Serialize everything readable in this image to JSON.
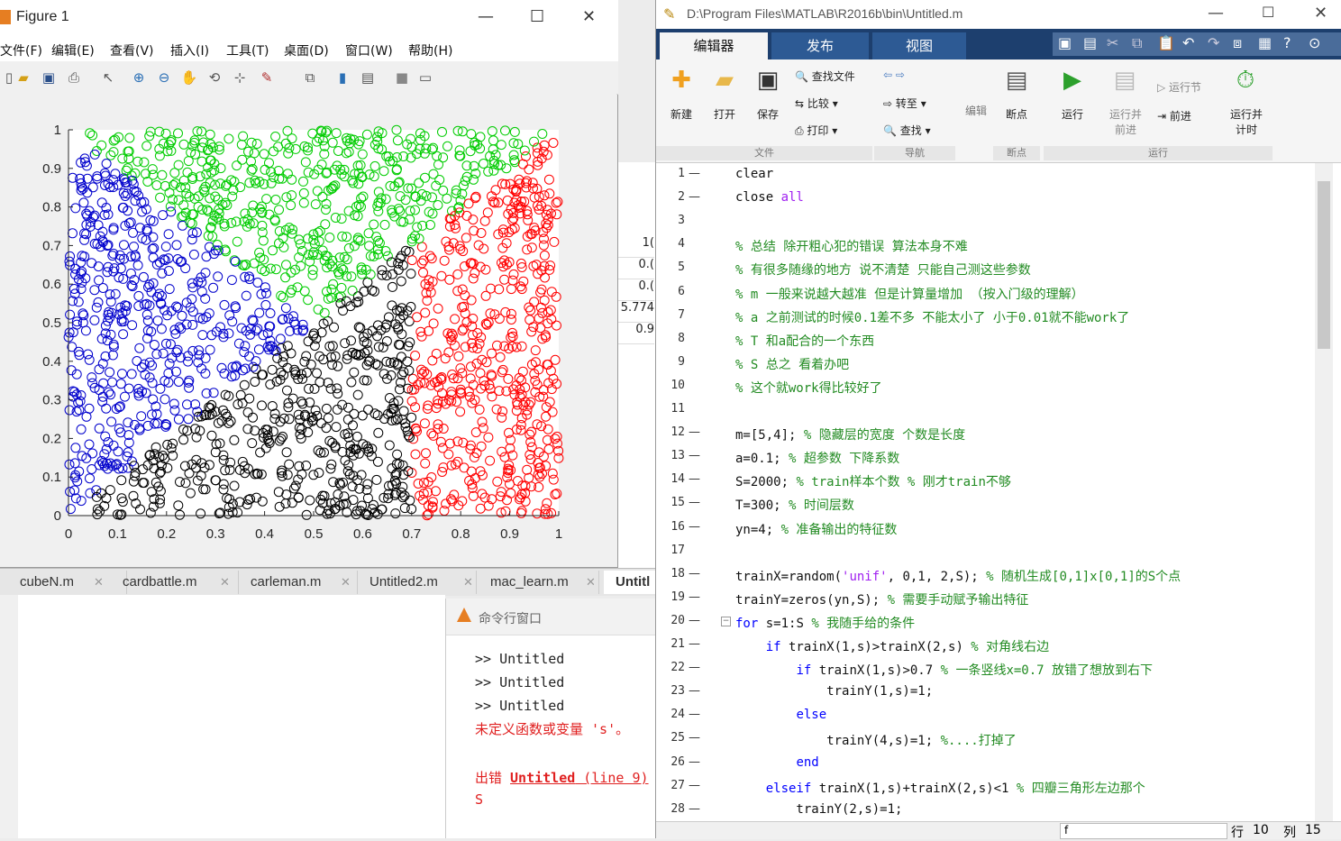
{
  "figure": {
    "title": "Figure 1",
    "menu": [
      "文件(F)",
      "编辑(E)",
      "查看(V)",
      "插入(I)",
      "工具(T)",
      "桌面(D)",
      "窗口(W)",
      "帮助(H)"
    ],
    "minimize": "—",
    "maximize": "☐",
    "close": "✕"
  },
  "chart_data": {
    "type": "scatter",
    "xlim": [
      0,
      1
    ],
    "ylim": [
      0,
      1
    ],
    "xticks": [
      "0",
      "0.1",
      "0.2",
      "0.3",
      "0.4",
      "0.5",
      "0.6",
      "0.7",
      "0.8",
      "0.9",
      "1"
    ],
    "yticks": [
      "0",
      "0.1",
      "0.2",
      "0.3",
      "0.4",
      "0.5",
      "0.6",
      "0.7",
      "0.8",
      "0.9",
      "1"
    ],
    "marker": "circle-open",
    "n_points": 2000,
    "series": [
      {
        "color": "#ff0000",
        "rule": "x > 0.7 (right of vertical line x=0.7, below diagonal)"
      },
      {
        "color": "#00cc00",
        "rule": "y > x and x + y > 1"
      },
      {
        "color": "#0000cc",
        "rule": "y > x and x + y < 1"
      },
      {
        "color": "#000000",
        "rule": "y < x and x + y < 1 or x < 0.7 below diagonal"
      }
    ],
    "colors": {
      "red": "#ff0000",
      "green": "#00cc00",
      "blue": "#0000cc",
      "black": "#000000"
    }
  },
  "editor": {
    "title": "D:\\Program Files\\MATLAB\\R2016b\\bin\\Untitled.m",
    "tabs": [
      "编辑器",
      "发布",
      "视图"
    ],
    "buttons": {
      "new": "新建",
      "open": "打开",
      "save": "保存",
      "find_files": "查找文件",
      "compare": "比较",
      "print": "打印",
      "goto": "转至",
      "find": "查找",
      "edit": "编辑",
      "breakpoint": "断点",
      "run": "运行",
      "run_advance": "运行并\n前进",
      "run_section": "运行节",
      "advance": "前进",
      "run_time": "运行并\n计时"
    },
    "sections": {
      "file": "文件",
      "nav": "导航",
      "bp": "断点",
      "run": "运行"
    },
    "lines": [
      {
        "n": "1",
        "d": "—",
        "t": "clear"
      },
      {
        "n": "2",
        "d": "—",
        "t": "close all"
      },
      {
        "n": "3",
        "d": "",
        "t": ""
      },
      {
        "n": "4",
        "d": "",
        "t": "% 总结 除开粗心犯的错误 算法本身不难"
      },
      {
        "n": "5",
        "d": "",
        "t": "% 有很多随缘的地方 说不清楚 只能自己测这些参数"
      },
      {
        "n": "6",
        "d": "",
        "t": "% m 一般来说越大越准 但是计算量增加 （按入门级的理解）"
      },
      {
        "n": "7",
        "d": "",
        "t": "% a 之前测试的时候0.1差不多 不能太小了 小于0.01就不能work了"
      },
      {
        "n": "8",
        "d": "",
        "t": "% T 和a配合的一个东西"
      },
      {
        "n": "9",
        "d": "",
        "t": "% S 总之 看着办吧"
      },
      {
        "n": "10",
        "d": "",
        "t": "% 这个就work得比较好了"
      },
      {
        "n": "11",
        "d": "",
        "t": ""
      },
      {
        "n": "12",
        "d": "—",
        "t": "m=[5,4]; % 隐藏层的宽度 个数是长度"
      },
      {
        "n": "13",
        "d": "—",
        "t": "a=0.1; % 超参数 下降系数"
      },
      {
        "n": "14",
        "d": "—",
        "t": "S=2000; % train样本个数 % 刚才train不够"
      },
      {
        "n": "15",
        "d": "—",
        "t": "T=300; % 时间层数"
      },
      {
        "n": "16",
        "d": "—",
        "t": "yn=4; % 准备输出的特征数"
      },
      {
        "n": "17",
        "d": "",
        "t": ""
      },
      {
        "n": "18",
        "d": "—",
        "t": "trainX=random('unif', 0,1, 2,S); % 随机生成[0,1]x[0,1]的S个点"
      },
      {
        "n": "19",
        "d": "—",
        "t": "trainY=zeros(yn,S); % 需要手动赋予输出特征"
      },
      {
        "n": "20",
        "d": "—",
        "t": "for s=1:S % 我随手给的条件"
      },
      {
        "n": "21",
        "d": "—",
        "t": "    if trainX(1,s)>trainX(2,s) % 对角线右边"
      },
      {
        "n": "22",
        "d": "—",
        "t": "        if trainX(1,s)>0.7 % 一条竖线x=0.7 放错了想放到右下"
      },
      {
        "n": "23",
        "d": "—",
        "t": "            trainY(1,s)=1;"
      },
      {
        "n": "24",
        "d": "—",
        "t": "        else"
      },
      {
        "n": "25",
        "d": "—",
        "t": "            trainY(4,s)=1; %....打掉了"
      },
      {
        "n": "26",
        "d": "—",
        "t": "        end"
      },
      {
        "n": "27",
        "d": "—",
        "t": "    elseif trainX(1,s)+trainX(2,s)<1 % 四瓣三角形左边那个"
      },
      {
        "n": "28",
        "d": "—",
        "t": "        trainY(2,s)=1;"
      }
    ],
    "status": {
      "func": "f",
      "row_label": "行",
      "row": "10",
      "col_label": "列",
      "col": "15"
    }
  },
  "file_tabs": [
    "cubeN.m",
    "cardbattle.m",
    "carleman.m",
    "Untitled2.m",
    "mac_learn.m",
    "Untitl"
  ],
  "command_window": {
    "title": "命令行窗口",
    "lines": [
      ">> Untitled",
      ">> Untitled",
      ">> Untitled"
    ],
    "error1": "未定义函数或变量 's'。",
    "error2_prefix": "出错 ",
    "error2_link": "Untitled",
    "error2_suffix": " (line 9)",
    "error3": "S"
  },
  "background_table": [
    "1(",
    "0.(",
    "0.(",
    "5.774",
    "0.9"
  ]
}
